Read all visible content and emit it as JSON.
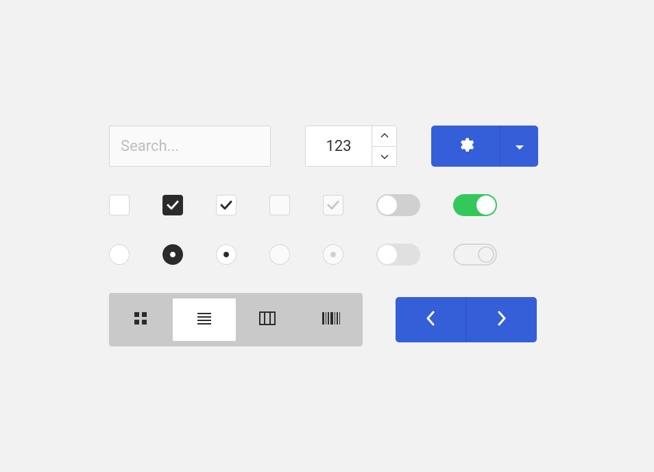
{
  "search": {
    "placeholder": "Search..."
  },
  "stepper": {
    "value": "123"
  },
  "colors": {
    "primary": "#355fd9",
    "success": "#34c759"
  }
}
